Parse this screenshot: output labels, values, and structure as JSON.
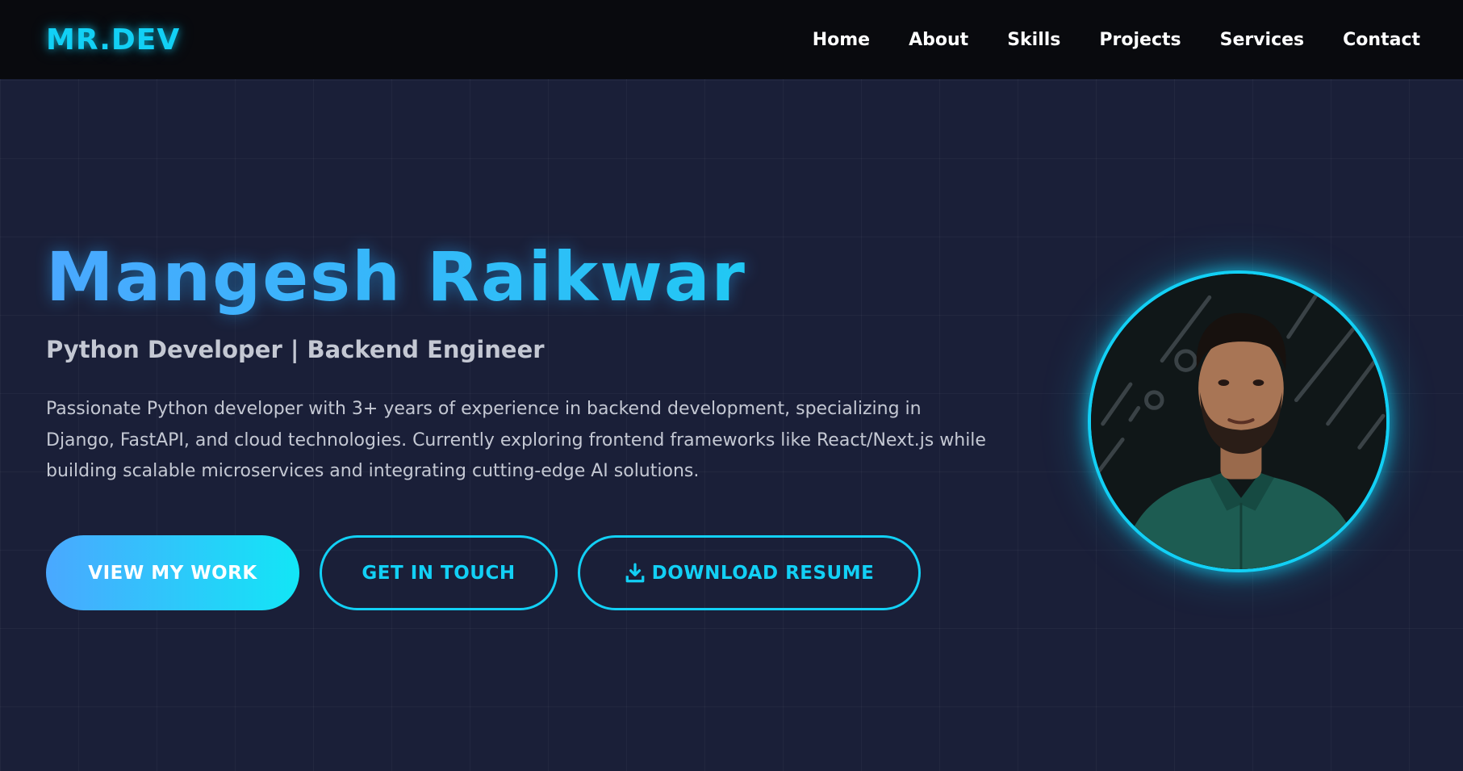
{
  "nav": {
    "logo": "MR.DEV",
    "links": [
      "Home",
      "About",
      "Skills",
      "Projects",
      "Services",
      "Contact"
    ]
  },
  "hero": {
    "name": "Mangesh Raikwar",
    "subtitle": "Python Developer | Backend Engineer",
    "description": "Passionate Python developer with 3+ years of experience in backend development, specializing in Django, FastAPI, and cloud technologies. Currently exploring frontend frameworks like React/Next.js while building scalable microservices and integrating cutting-edge AI solutions.",
    "buttons": {
      "view_work": "VIEW MY WORK",
      "get_in_touch": "GET IN TOUCH",
      "download_resume": "DOWNLOAD RESUME"
    }
  },
  "icons": {
    "download": "download-icon",
    "avatar": "profile-photo"
  },
  "colors": {
    "accent": "#12d0f5",
    "gradient_start": "#4aa8ff",
    "gradient_end": "#12e6f6",
    "background": "#1a1f38",
    "navbar": "#090a0e"
  }
}
